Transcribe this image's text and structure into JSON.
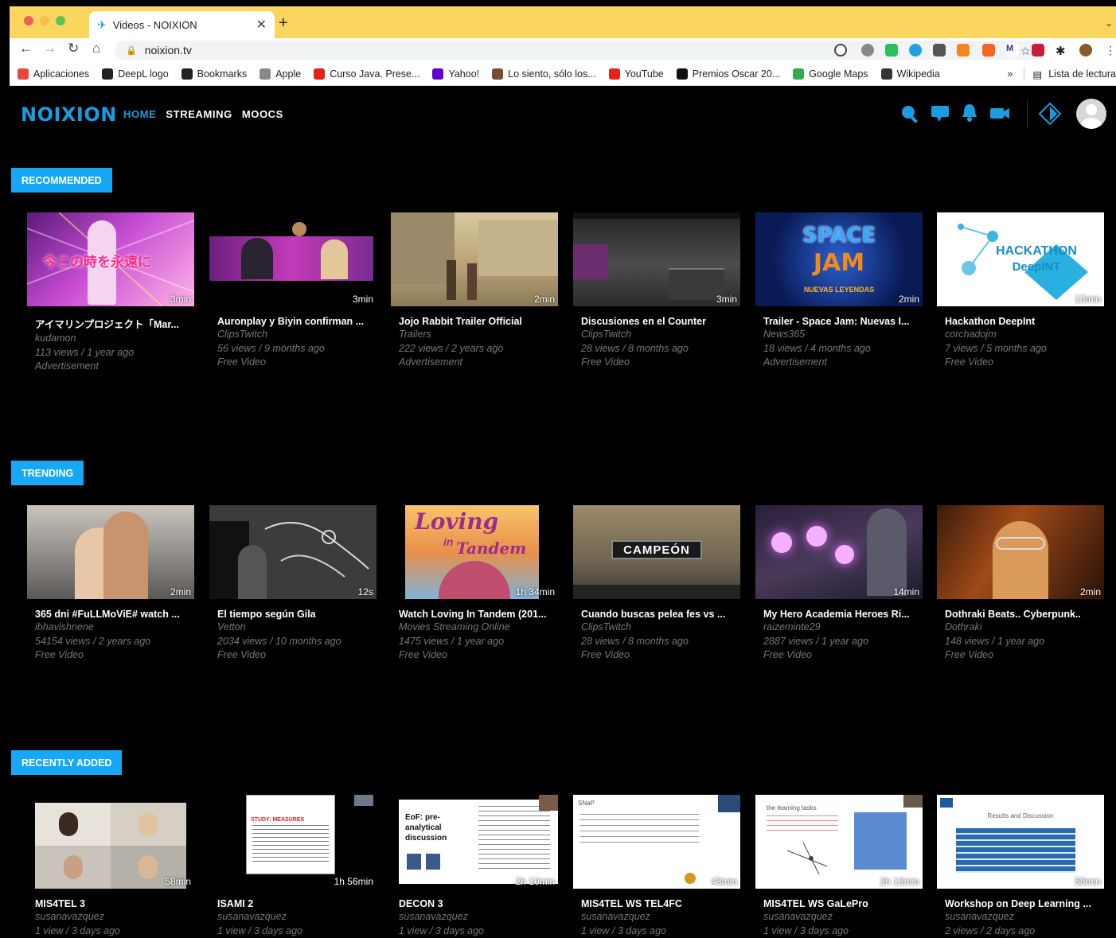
{
  "browser": {
    "tab_title": "Videos - NOIXION",
    "new_tab": "+",
    "url": "noixion.tv",
    "bookmarks": [
      {
        "label": "Aplicaciones",
        "icon": "apps-grid-icon",
        "color": "#e9483a"
      },
      {
        "label": "DeepL logo",
        "icon": "deepl-icon",
        "color": "#222222"
      },
      {
        "label": "Bookmarks",
        "icon": "star-icon",
        "color": "#222222"
      },
      {
        "label": "Apple",
        "icon": "apple-icon",
        "color": "#888888"
      },
      {
        "label": "Curso Java. Prese...",
        "icon": "youtube-icon",
        "color": "#e62117"
      },
      {
        "label": "Yahoo!",
        "icon": "yahoo-icon",
        "color": "#6001d2"
      },
      {
        "label": "Lo siento, sólo los...",
        "icon": "site-icon",
        "color": "#7a4b32"
      },
      {
        "label": "YouTube",
        "icon": "youtube-icon",
        "color": "#e62117"
      },
      {
        "label": "Premios Oscar 20...",
        "icon": "n-icon",
        "color": "#111111"
      },
      {
        "label": "Google Maps",
        "icon": "maps-pin-icon",
        "color": "#34a853"
      },
      {
        "label": "Wikipedia",
        "icon": "wikipedia-icon",
        "color": "#333333"
      }
    ],
    "bookmarks_more": "»",
    "reading_list": "Lista de lectura"
  },
  "site": {
    "logo": "NOIXION",
    "nav": [
      {
        "label": "HOME",
        "active": true
      },
      {
        "label": "STREAMING",
        "active": false
      },
      {
        "label": "MOOCS",
        "active": false
      }
    ],
    "accent": "#1a9ce0"
  },
  "sections": [
    {
      "label": "RECOMMENDED",
      "cards": [
        {
          "title": "アイマリンプロジェクト「Mar...",
          "channel": "kudamon",
          "stats": "113 views / 1 year ago",
          "type": "Advertisement",
          "duration": "3min",
          "thumb": "idol"
        },
        {
          "title": "Auronplay y Biyin confirman ...",
          "channel": "ClipsTwitch",
          "stats": "56 views / 9 months ago",
          "type": "Free Video",
          "duration": "3min",
          "thumb": "stream"
        },
        {
          "title": "Jojo Rabbit Trailer Official",
          "channel": "Trailers",
          "stats": "222 views / 2 years ago",
          "type": "Advertisement",
          "duration": "2min",
          "thumb": "street"
        },
        {
          "title": "Discusiones en el Counter",
          "channel": "ClipsTwitch",
          "stats": "28 views / 8 months ago",
          "type": "Free Video",
          "duration": "3min",
          "thumb": "fps"
        },
        {
          "title": "Trailer - Space Jam: Nuevas I...",
          "channel": "News365",
          "stats": "18 views / 4 months ago",
          "type": "Advertisement",
          "duration": "2min",
          "thumb": "spacejam"
        },
        {
          "title": "Hackathon DeepInt",
          "channel": "corchadojm",
          "stats": "7 views / 5 months ago",
          "type": "Free Video",
          "duration": "13min",
          "thumb": "hackathon"
        }
      ]
    },
    {
      "label": "TRENDING",
      "cards": [
        {
          "title": "365 dni #FuLLMoViE# watch ...",
          "channel": "ibhavishnene",
          "stats": "54154 views / 2 years ago",
          "type": "Free Video",
          "duration": "2min",
          "thumb": "couple"
        },
        {
          "title": "El tiempo según Gila",
          "channel": "Vetton",
          "stats": "2034 views / 10 months ago",
          "type": "Free Video",
          "duration": "12s",
          "thumb": "chalk"
        },
        {
          "title": "Watch Loving In Tandem (201...",
          "channel": "Movies Streaming Online",
          "stats": "1475 views / 1 year ago",
          "type": "Free Video",
          "duration": "1h 34min",
          "thumb": "tandem"
        },
        {
          "title": "Cuando buscas pelea fes vs ...",
          "channel": "ClipsTwitch",
          "stats": "28 views / 8 months ago",
          "type": "Free Video",
          "duration": "",
          "thumb": "campeon"
        },
        {
          "title": "My Hero Academia Heroes Ri...",
          "channel": "raizeminte29",
          "stats": "2887 views / 1 year ago",
          "type": "Free Video",
          "duration": "14min",
          "thumb": "hero"
        },
        {
          "title": "Dothraki Beats.. Cyberpunk..",
          "channel": "Dothraki",
          "stats": "148 views / 1 year ago",
          "type": "Free Video",
          "duration": "2min",
          "thumb": "cyber"
        }
      ]
    },
    {
      "label": "RECENTLY ADDED",
      "cards": [
        {
          "title": "MIS4TEL 3",
          "channel": "susanavazquez",
          "stats": "1 view / 3 days ago",
          "type": "",
          "duration": "58min",
          "thumb": "meeting"
        },
        {
          "title": "ISAMI 2",
          "channel": "susanavazquez",
          "stats": "1 view / 3 days ago",
          "type": "",
          "duration": "1h 56min",
          "thumb": "slide1"
        },
        {
          "title": "DECON 3",
          "channel": "susanavazquez",
          "stats": "1 view / 3 days ago",
          "type": "",
          "duration": "2h 10min",
          "thumb": "slide2"
        },
        {
          "title": "MIS4TEL WS TEL4FC",
          "channel": "susanavazquez",
          "stats": "1 view / 3 days ago",
          "type": "",
          "duration": "43min",
          "thumb": "slide3"
        },
        {
          "title": "MIS4TEL WS GaLePro",
          "channel": "susanavazquez",
          "stats": "1 view / 3 days ago",
          "type": "",
          "duration": "2h 13min",
          "thumb": "slide4"
        },
        {
          "title": "Workshop on Deep Learning ...",
          "channel": "susanavazquez",
          "stats": "2 views / 2 days ago",
          "type": "",
          "duration": "58min",
          "thumb": "slide5"
        }
      ]
    }
  ],
  "thumb_text": {
    "idol": "今この時を永遠に",
    "spacejam_1": "SPACE",
    "spacejam_2": "JAM",
    "spacejam_3": "NUEVAS LEYENDAS",
    "hackathon_1": "HACKATHON",
    "hackathon_2": "DeepINT",
    "tandem_1": "Loving",
    "tandem_2": "in",
    "tandem_3": "Tandem",
    "campeon": "CAMPEÓN",
    "slide1": "STUDY: MEASURES",
    "slide2": "EoF: pre-analytical discussion",
    "slide3": "SNaP",
    "slide4": "the learning tasks",
    "slide5": "Results and Discussion"
  }
}
